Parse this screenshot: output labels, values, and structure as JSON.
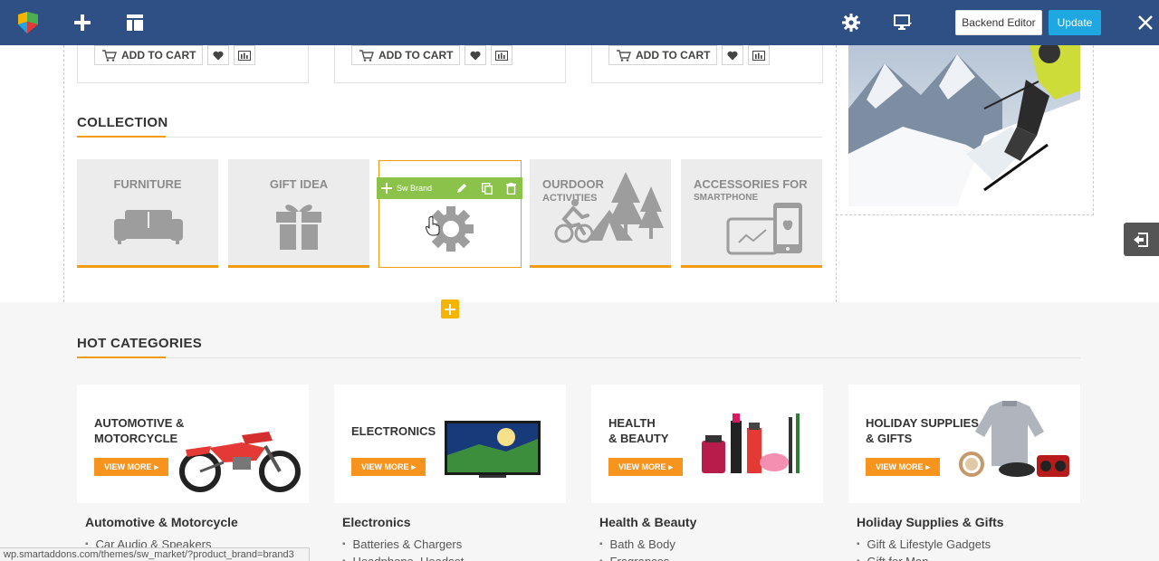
{
  "toolbar": {
    "backend_label": "Backend Editor",
    "update_label": "Update"
  },
  "products": {
    "add_to_cart_label": "ADD TO CART"
  },
  "collection": {
    "title": "COLLECTION",
    "tiles": [
      {
        "label": "FURNITURE"
      },
      {
        "label": "GIFT IDEA"
      },
      {
        "label": ""
      },
      {
        "label": "OURDOOR",
        "sub": "ACTIVITIES"
      },
      {
        "label": "ACCESSORIES FOR",
        "sub": "SMARTPHONE"
      }
    ],
    "element_toolbar_label": "Sw Brand"
  },
  "hot_categories": {
    "title": "HOT CATEGORIES",
    "view_more_label": "VIEW MORE",
    "cards": [
      {
        "title_line1": "AUTOMOTIVE &",
        "title_line2": "MOTORCYCLE",
        "name": "Automotive & Motorcycle",
        "items": [
          "Car Audio & Speakers"
        ]
      },
      {
        "title_line1": "ELECTRONICS",
        "title_line2": "",
        "name": "Electronics",
        "items": [
          "Batteries & Chargers",
          "Headphone, Headset"
        ]
      },
      {
        "title_line1": "HEALTH",
        "title_line2": "& BEAUTY",
        "name": "Health & Beauty",
        "items": [
          "Bath & Body",
          "Fragrances"
        ]
      },
      {
        "title_line1": "HOLIDAY SUPPLIES",
        "title_line2": "& GIFTS",
        "name": "Holiday Supplies & Gifts",
        "items": [
          "Gift & Lifestyle Gadgets",
          "Gift for Man"
        ]
      }
    ]
  },
  "status_url": "wp.smartaddons.com/themes/sw_market/?product_brand=brand3",
  "colors": {
    "topbar": "#2f5085",
    "accent_orange": "#f39c12",
    "update_blue": "#1ea7e0",
    "element_green": "#8bc34a"
  }
}
